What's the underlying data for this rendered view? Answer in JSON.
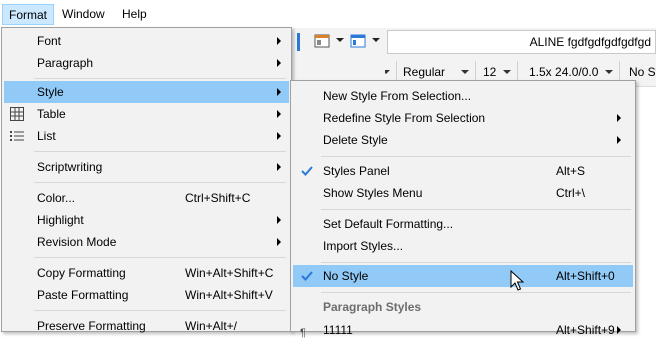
{
  "menubar": {
    "format": "Format",
    "window": "Window",
    "help": "Help"
  },
  "toolbar": {
    "title_field": "ALINE fgdfgdfgdfgdfgd",
    "style_combo": "Regular",
    "size_combo": "12",
    "spacing_combo": "1.5x 24.0/0.0",
    "style_name_combo": "No Style"
  },
  "format_menu": {
    "font": "Font",
    "paragraph": "Paragraph",
    "style": "Style",
    "table": "Table",
    "list": "List",
    "scriptwriting": "Scriptwriting",
    "color": "Color...",
    "color_shortcut": "Ctrl+Shift+C",
    "highlight": "Highlight",
    "revision_mode": "Revision Mode",
    "copy_formatting": "Copy Formatting",
    "copy_formatting_shortcut": "Win+Alt+Shift+C",
    "paste_formatting": "Paste Formatting",
    "paste_formatting_shortcut": "Win+Alt+Shift+V",
    "preserve_formatting": "Preserve Formatting",
    "preserve_formatting_shortcut": "Win+Alt+/"
  },
  "style_menu": {
    "new_style": "New Style From Selection...",
    "redefine_style": "Redefine Style From Selection",
    "delete_style": "Delete Style",
    "styles_panel": "Styles Panel",
    "styles_panel_shortcut": "Alt+S",
    "show_styles_menu": "Show Styles Menu",
    "show_styles_menu_shortcut": "Ctrl+\\",
    "set_default": "Set Default Formatting...",
    "import_styles": "Import Styles...",
    "no_style": "No Style",
    "no_style_shortcut": "Alt+Shift+0",
    "paragraph_styles_header": "Paragraph Styles",
    "partial_item": "11111",
    "partial_shortcut": "Alt+Shift+9"
  },
  "colors": {
    "highlight": "#91c9f7",
    "menu_bg": "#f2f2f2",
    "menubar_active": "#cce8ff",
    "check": "#2b78d6"
  }
}
